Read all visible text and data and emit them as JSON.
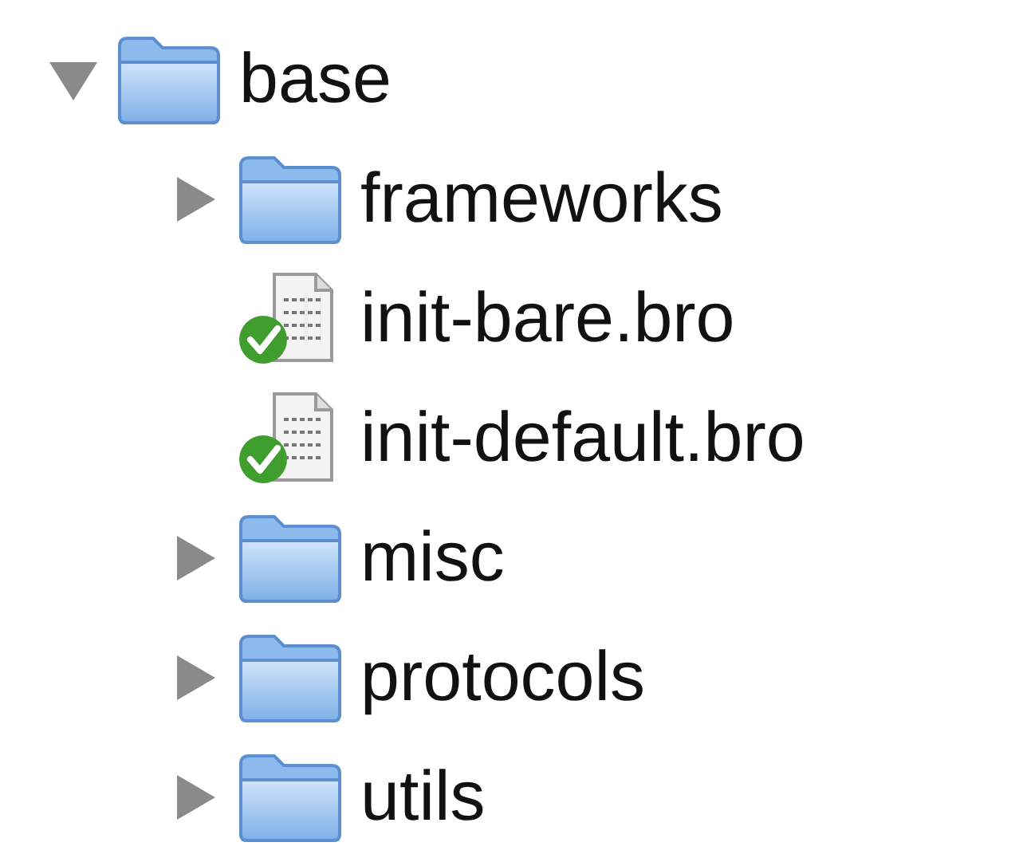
{
  "tree": [
    {
      "name": "base",
      "kind": "folder",
      "expanded": true,
      "children": [
        {
          "name": "frameworks",
          "kind": "folder",
          "expanded": false
        },
        {
          "name": "init-bare.bro",
          "kind": "file",
          "checked": true
        },
        {
          "name": "init-default.bro",
          "kind": "file",
          "checked": true
        },
        {
          "name": "misc",
          "kind": "folder",
          "expanded": false
        },
        {
          "name": "protocols",
          "kind": "folder",
          "expanded": false
        },
        {
          "name": "utils",
          "kind": "folder",
          "expanded": false
        }
      ]
    }
  ]
}
